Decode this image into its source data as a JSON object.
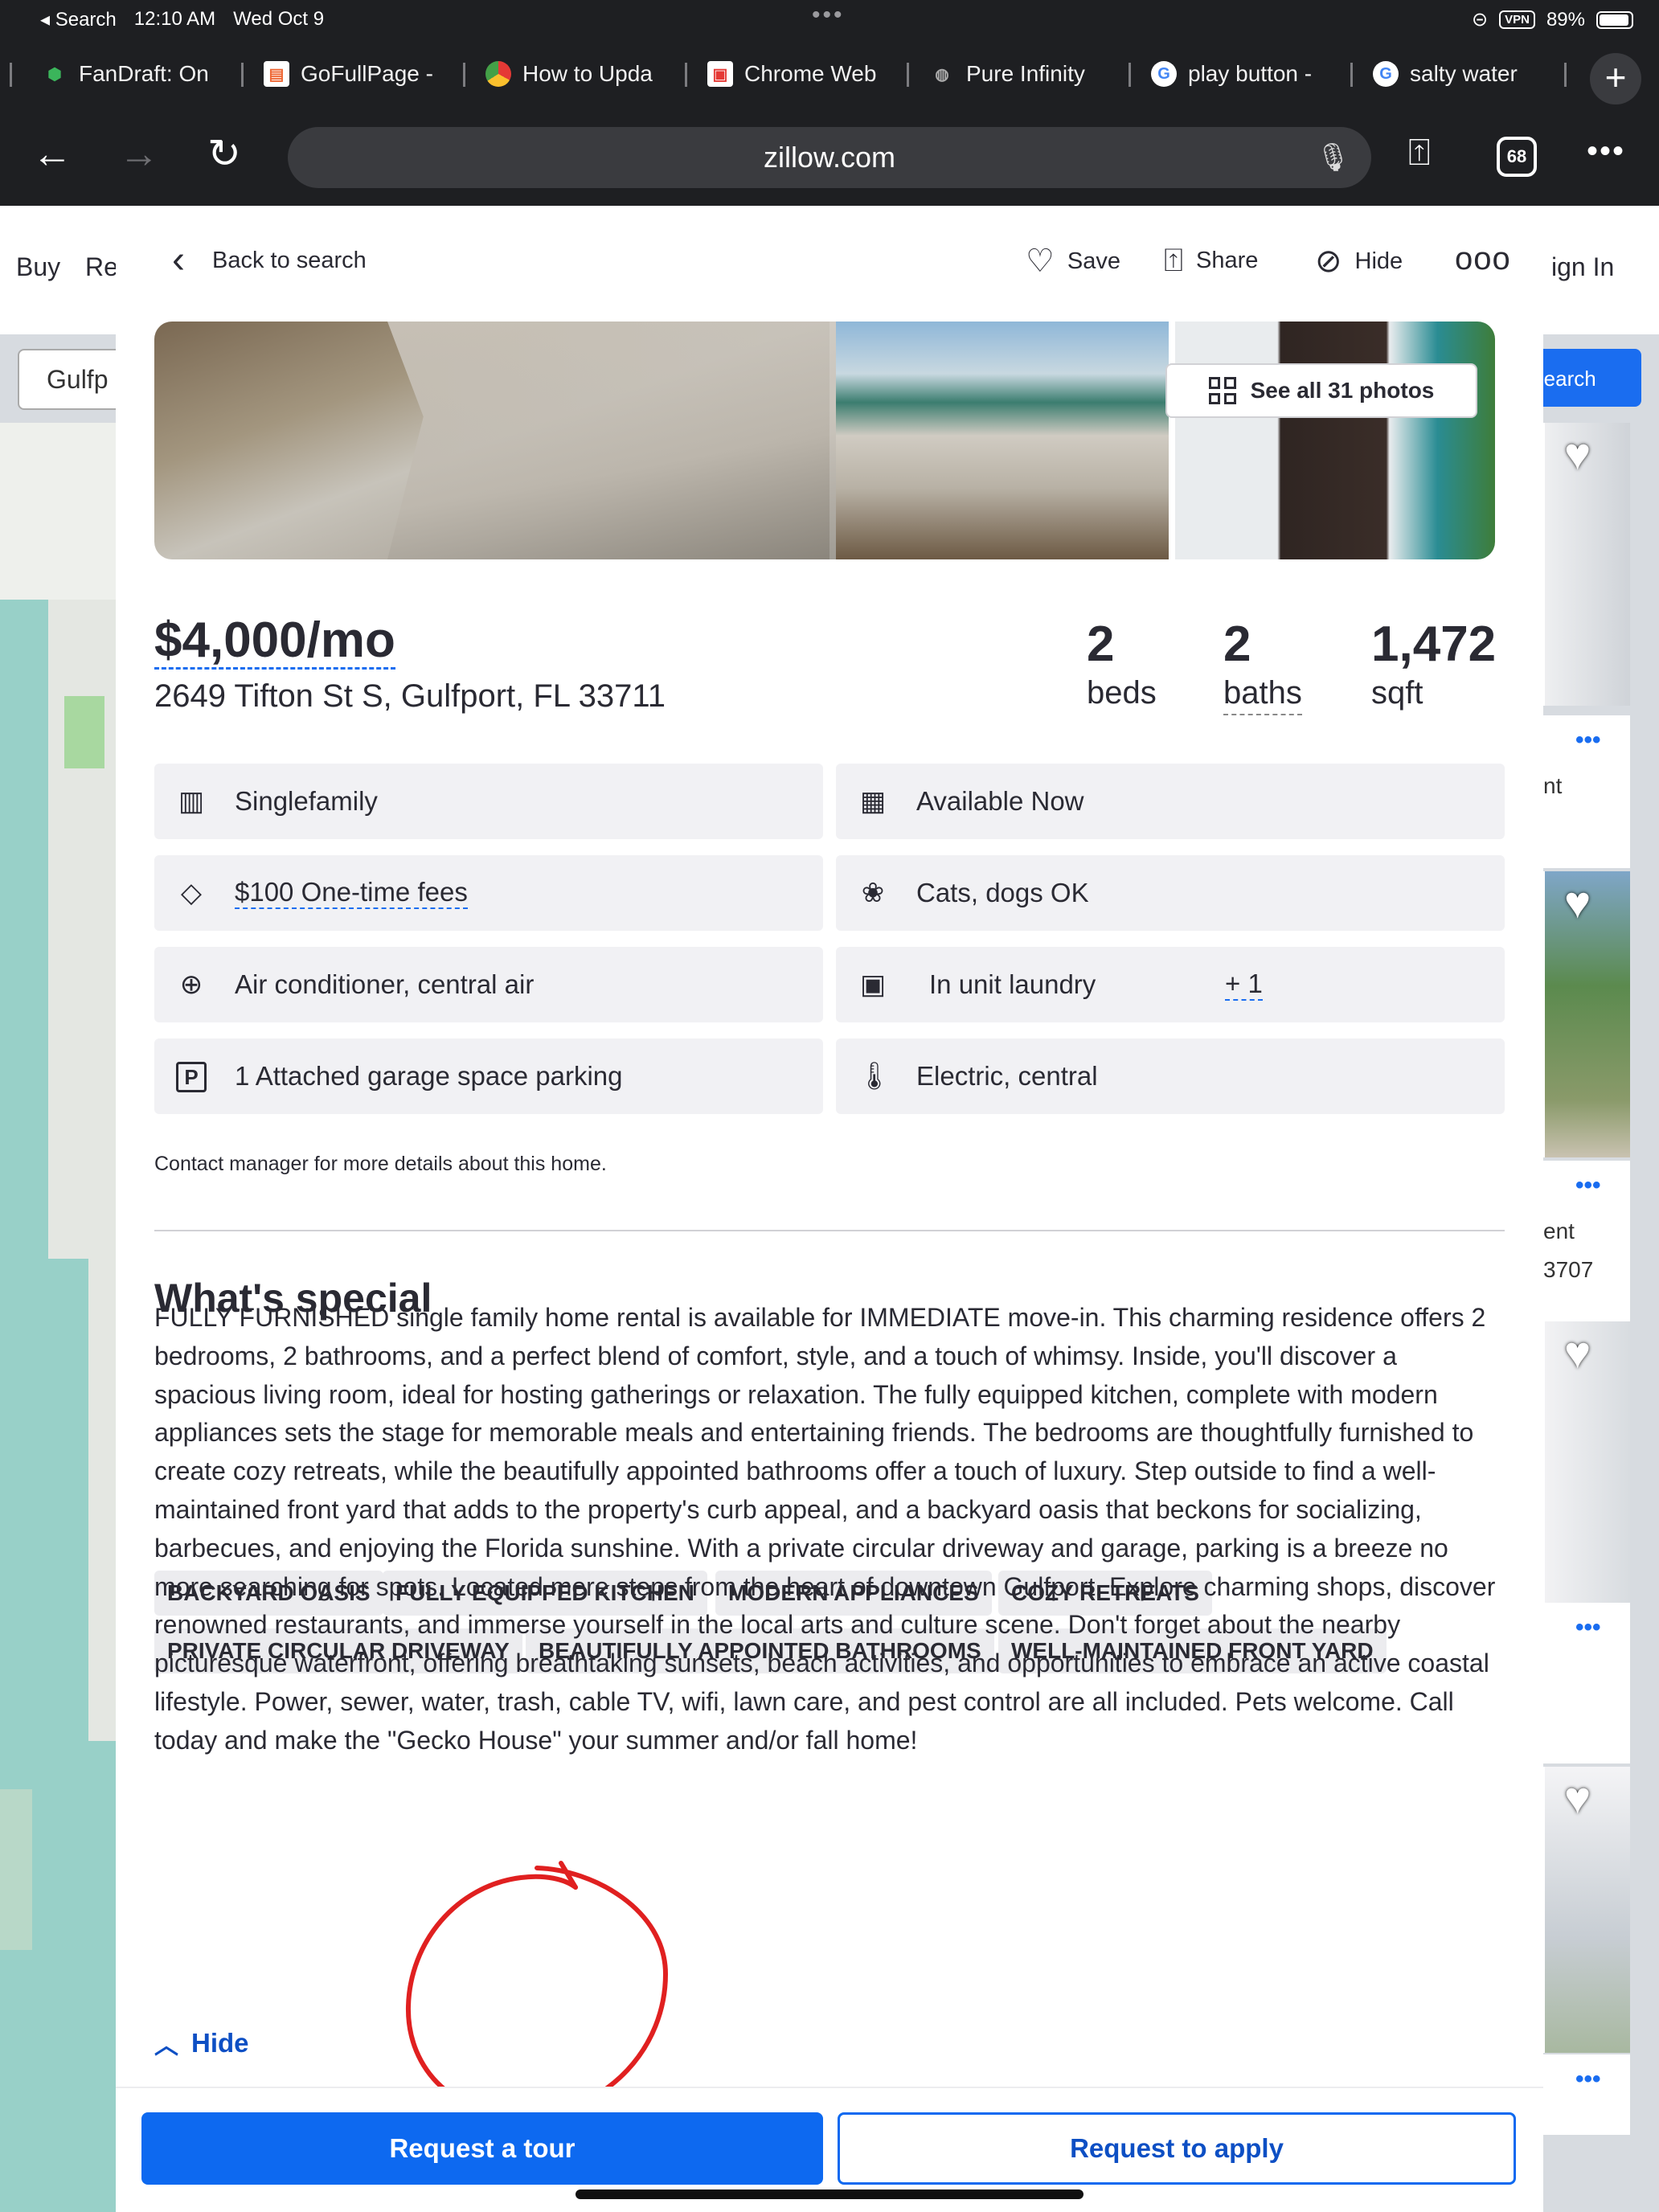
{
  "status_bar": {
    "back_app": "◂ Search",
    "time": "12:10 AM",
    "date": "Wed Oct 9",
    "vpn": "VPN",
    "battery": "89%"
  },
  "browser_tabs": [
    {
      "title": "FanDraft: On",
      "icon": "shield-icon"
    },
    {
      "title": "GoFullPage -",
      "icon": "gofullpage-icon"
    },
    {
      "title": "How to Upda",
      "icon": "chrome-icon"
    },
    {
      "title": "Chrome Web",
      "icon": "chrome-store-icon"
    },
    {
      "title": "Pure Infinity",
      "icon": "globe-icon"
    },
    {
      "title": "play button -",
      "icon": "google-icon"
    },
    {
      "title": "salty water",
      "icon": "google-icon"
    }
  ],
  "url_bar": {
    "url": "zillow.com",
    "tab_count": "68"
  },
  "background_page": {
    "nav": [
      "Buy",
      "Re",
      "ign In"
    ],
    "search_value": "Gulfp",
    "save_search_label": "e search",
    "card_texts": [
      "nt",
      "ent",
      "3707"
    ]
  },
  "header": {
    "back_label": "Back to search",
    "save_label": "Save",
    "share_label": "Share",
    "hide_label": "Hide"
  },
  "photos": {
    "see_all_label": "See all 31 photos"
  },
  "listing": {
    "price": "$4,000/mo",
    "address": "2649 Tifton St S, Gulfport, FL 33711",
    "beds": "2",
    "beds_label": "beds",
    "baths": "2",
    "baths_label": "baths",
    "sqft": "1,472",
    "sqft_label": "sqft"
  },
  "facts": [
    {
      "label": "Singlefamily",
      "icon": "building-icon"
    },
    {
      "label": "Available Now",
      "icon": "calendar-icon"
    },
    {
      "label": "$100 One-time fees",
      "icon": "price-tag-icon"
    },
    {
      "label": "Cats, dogs OK",
      "icon": "paw-icon"
    },
    {
      "label": "Air conditioner, central air",
      "icon": "fan-icon"
    },
    {
      "label": "In unit laundry",
      "extra": "+ 1",
      "icon": "washer-icon"
    },
    {
      "label": "1 Attached garage space parking",
      "icon": "parking-icon"
    },
    {
      "label": "Electric, central",
      "icon": "thermometer-icon"
    }
  ],
  "contact_note": "Contact manager for more details about this home.",
  "whats_special": {
    "title": "What's special",
    "tags": [
      "BACKYARD OASIS",
      "FULLY EQUIPPED KITCHEN",
      "MODERN APPLIANCES",
      "COZY RETREATS",
      "PRIVATE CIRCULAR DRIVEWAY",
      "BEAUTIFULLY APPOINTED BATHROOMS",
      "WELL-MAINTAINED FRONT YARD"
    ],
    "description": "FULLY FURNISHED single family home rental is available for IMMEDIATE move-in. This charming residence offers 2 bedrooms, 2 bathrooms, and a perfect blend of comfort, style, and a touch of whimsy. Inside, you'll discover a spacious living room, ideal for hosting gatherings or relaxation. The fully equipped kitchen, complete with modern appliances sets the stage for memorable meals and entertaining friends. The bedrooms are thoughtfully furnished to create cozy retreats, while the beautifully appointed bathrooms offer a touch of luxury. Step outside to find a well-maintained front yard that adds to the property's curb appeal, and a backyard oasis that beckons for socializing, barbecues, and enjoying the Florida sunshine. With a private circular driveway and garage, parking is a breeze no more searching for spots. Located mere steps from the heart of downtown Gulfport. Explore charming shops, discover renowned restaurants, and immerse yourself in the local arts and culture scene. Don't forget about the nearby picturesque waterfront, offering breathtaking sunsets, beach activities, and opportunities to embrace an active coastal lifestyle. Power, sewer, water, trash, cable TV, wifi, lawn care, and pest control are all included. Pets welcome. Call today and make the \"Gecko House\" your summer and/or fall home!",
    "hide_label": "Hide"
  },
  "footer": {
    "tour_label": "Request a tour",
    "apply_label": "Request to apply"
  },
  "colors": {
    "primary_blue": "#0d69f0",
    "link_blue": "#0d4fc4",
    "annotation_red": "#e02020"
  }
}
